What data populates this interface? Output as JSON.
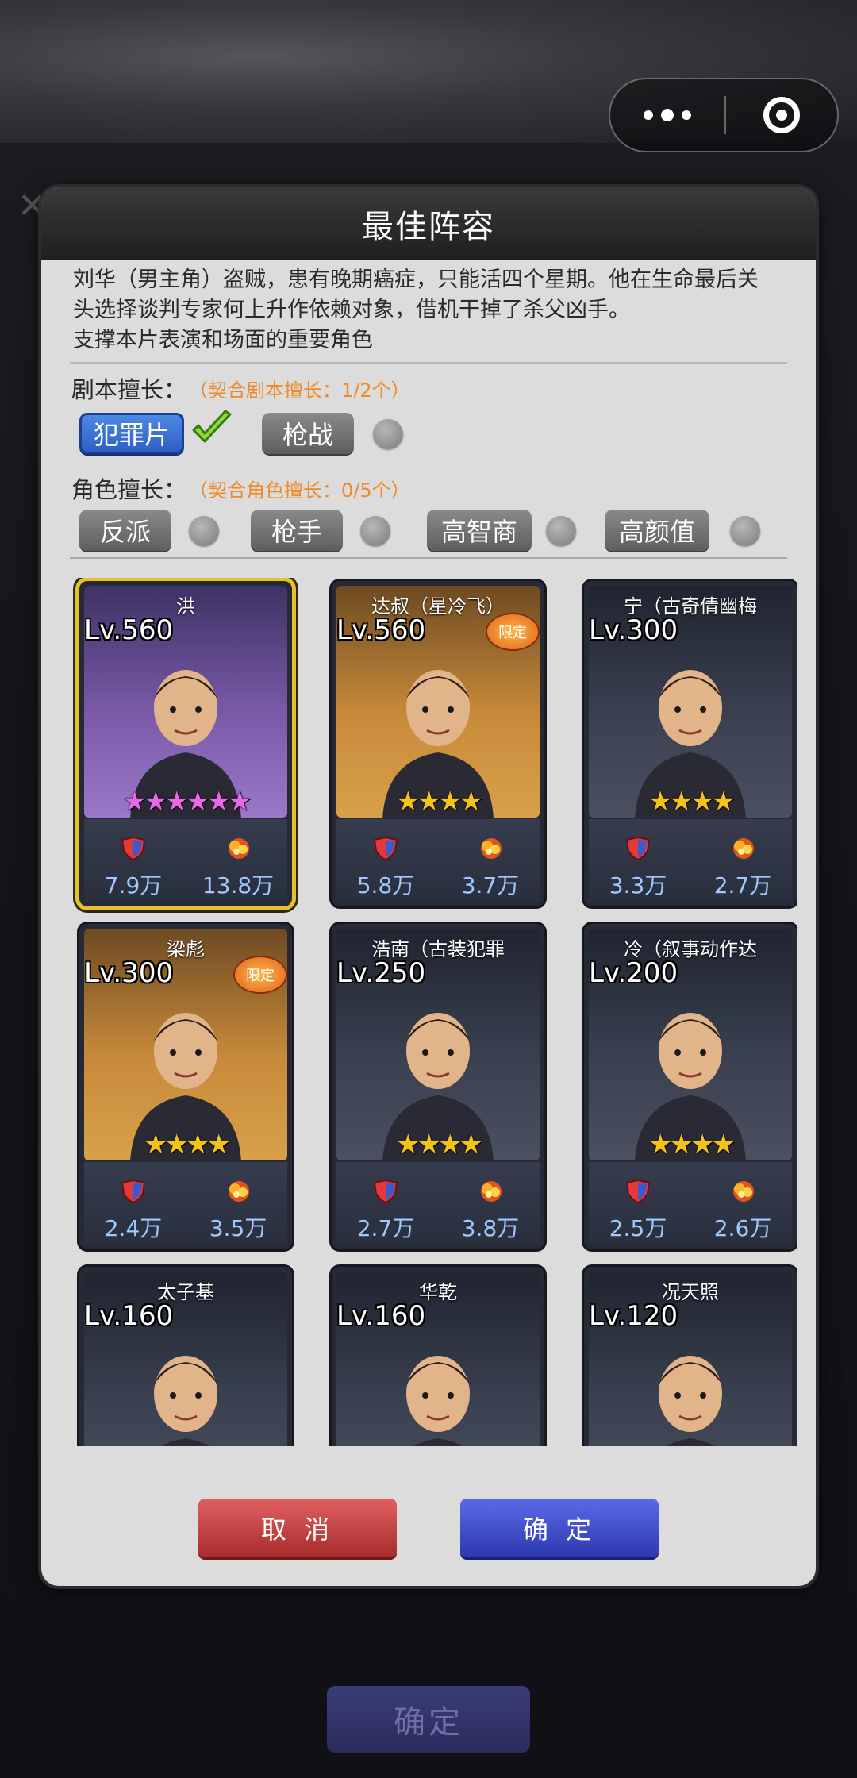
{
  "background": {
    "confirm_label": "确定"
  },
  "capsule": {
    "more_icon": "more-dots",
    "close_icon": "target-circle"
  },
  "modal": {
    "title": "最佳阵容",
    "description_lines": [
      "刘华（男主角）盗贼，患有晚期癌症，只能活四个星期。他在生命最后关",
      "头选择谈判专家何上升作依赖对象，借机干掉了杀父凶手。",
      "支撑本片表演和场面的重要角色"
    ],
    "script_skill": {
      "label": "剧本擅长：",
      "hint": "（契合剧本擅长：1/2个）",
      "tags": [
        {
          "label": "犯罪片",
          "matched": true
        },
        {
          "label": "枪战",
          "matched": false
        }
      ]
    },
    "role_skill": {
      "label": "角色擅长：",
      "hint": "（契合角色擅长：0/5个）",
      "tags": [
        {
          "label": "反派",
          "matched": false
        },
        {
          "label": "枪手",
          "matched": false
        },
        {
          "label": "高智商",
          "matched": false
        },
        {
          "label": "高颜值",
          "matched": false
        }
      ]
    },
    "cards": [
      {
        "name": "洪",
        "level": "Lv.560",
        "stars": 6,
        "star_color": "pink",
        "bg": "purple",
        "limited": false,
        "selected": true,
        "stat1": "7.9万",
        "stat2": "13.8万"
      },
      {
        "name": "达叔（星冷飞）",
        "level": "Lv.560",
        "stars": 4,
        "star_color": "gold",
        "bg": "orange",
        "limited": true,
        "limited_label": "限定",
        "selected": false,
        "stat1": "5.8万",
        "stat2": "3.7万"
      },
      {
        "name": "宁（古奇倩幽梅",
        "level": "Lv.300",
        "stars": 4,
        "star_color": "gold",
        "bg": "dark",
        "limited": false,
        "selected": false,
        "stat1": "3.3万",
        "stat2": "2.7万"
      },
      {
        "name": "梁彪",
        "level": "Lv.300",
        "stars": 4,
        "star_color": "gold",
        "bg": "orange",
        "limited": true,
        "limited_label": "限定",
        "selected": false,
        "stat1": "2.4万",
        "stat2": "3.5万"
      },
      {
        "name": "浩南（古装犯罪",
        "level": "Lv.250",
        "stars": 4,
        "star_color": "gold",
        "bg": "dark",
        "limited": false,
        "selected": false,
        "stat1": "2.7万",
        "stat2": "3.8万"
      },
      {
        "name": "冷（叙事动作达",
        "level": "Lv.200",
        "stars": 4,
        "star_color": "gold",
        "bg": "dark",
        "limited": false,
        "selected": false,
        "stat1": "2.5万",
        "stat2": "2.6万"
      },
      {
        "name": "太子基",
        "level": "Lv.160",
        "stars": 0,
        "star_color": "gold",
        "bg": "dark",
        "limited": false,
        "selected": false,
        "stat1": "",
        "stat2": ""
      },
      {
        "name": "华乾",
        "level": "Lv.160",
        "stars": 0,
        "star_color": "gold",
        "bg": "dark",
        "limited": false,
        "selected": false,
        "stat1": "",
        "stat2": ""
      },
      {
        "name": "况天照",
        "level": "Lv.120",
        "stars": 0,
        "star_color": "gold",
        "bg": "dark",
        "limited": false,
        "selected": false,
        "stat1": "",
        "stat2": ""
      }
    ],
    "cancel_label": "取 消",
    "confirm_label": "确 定"
  }
}
